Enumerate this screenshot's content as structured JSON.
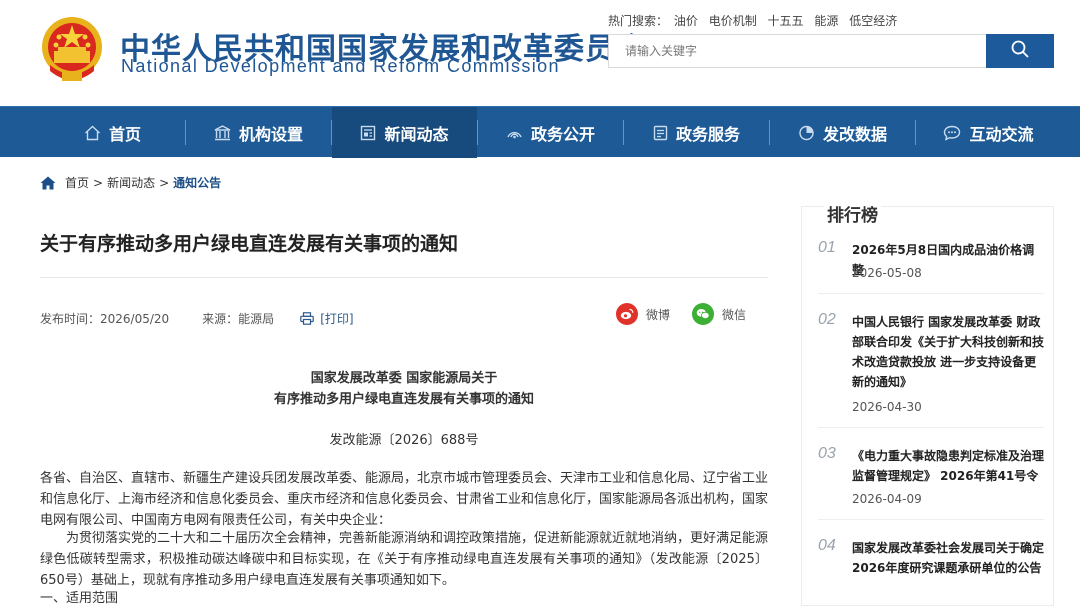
{
  "header": {
    "title_cn": "中华人民共和国国家发展和改革委员会",
    "title_en": "National Development and Reform Commission",
    "hot_search_label": "热门搜索：",
    "hot_search_items": [
      "油价",
      "电价机制",
      "十五五",
      "能源",
      "低空经济"
    ],
    "search_placeholder": "请输入关键字",
    "accent_color": "#1d5a96"
  },
  "nav": {
    "items": [
      {
        "label": "首页",
        "icon": "home-icon"
      },
      {
        "label": "机构设置",
        "icon": "building-icon"
      },
      {
        "label": "新闻动态",
        "icon": "news-icon",
        "active": true
      },
      {
        "label": "政务公开",
        "icon": "broadcast-icon"
      },
      {
        "label": "政务服务",
        "icon": "document-icon"
      },
      {
        "label": "发改数据",
        "icon": "pie-chart-icon"
      },
      {
        "label": "互动交流",
        "icon": "chat-icon"
      }
    ]
  },
  "breadcrumb": {
    "home": "首页",
    "sep1": ">",
    "section": "新闻动态",
    "sep2": ">",
    "current": "通知公告"
  },
  "article": {
    "title": "关于有序推动多用户绿电直连发展有关事项的通知",
    "publish_date": "发布时间：2026/05/20",
    "source": "来源：能源局",
    "print_label": "[打印]",
    "share_weibo": "微博",
    "share_wechat": "微信",
    "doc_head_line1": "国家发展改革委 国家能源局关于",
    "doc_head_line2": "有序推动多用户绿电直连发展有关事项的通知",
    "doc_number": "发改能源〔2026〕688号",
    "paragraph1": "各省、自治区、直辖市、新疆生产建设兵团发展改革委、能源局，北京市城市管理委员会、天津市工业和信息化局、辽宁省工业和信息化厅、上海市经济和信息化委员会、重庆市经济和信息化委员会、甘肃省工业和信息化厅，国家能源局各派出机构，国家电网有限公司、中国南方电网有限责任公司，有关中央企业：",
    "paragraph2": "为贯彻落实党的二十大和二十届历次全会精神，完善新能源消纳和调控政策措施，促进新能源就近就地消纳，更好满足能源绿色低碳转型需求，积极推动碳达峰碳中和目标实现，在《关于有序推动绿电直连发展有关事项的通知》（发改能源〔2025〕650号）基础上，现就有序推动多用户绿电直连发展有关事项通知如下。",
    "paragraph3": "一、适用范围"
  },
  "ranking": {
    "title": "排行榜",
    "items": [
      {
        "num": "01",
        "text": "2026年5月8日国内成品油价格调整",
        "date": "2026-05-08"
      },
      {
        "num": "02",
        "text": "中国人民银行 国家发展改革委 财政部联合印发《关于扩大科技创新和技术改造贷款投放 进一步支持设备更新的通知》",
        "date": "2026-04-30"
      },
      {
        "num": "03",
        "text": "《电力重大事故隐患判定标准及治理监督管理规定》 2026年第41号令",
        "date": "2026-04-09"
      },
      {
        "num": "04",
        "text": "国家发展改革委社会发展司关于确定2026年度研究课题承研单位的公告",
        "date": ""
      }
    ]
  }
}
